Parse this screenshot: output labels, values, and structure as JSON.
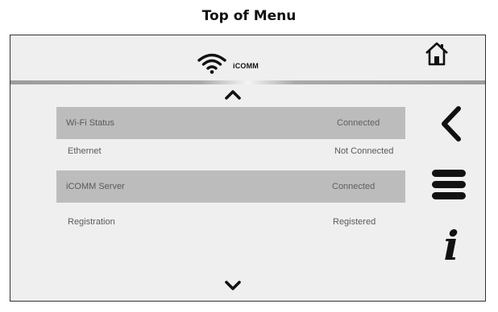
{
  "page": {
    "caption": "Top of Menu"
  },
  "header": {
    "brand": "iCOMM",
    "icons": {
      "wifi": "wifi-icon",
      "home": "home-icon"
    }
  },
  "navigation": {
    "scroll_up_icon": "chevron-up-icon",
    "scroll_down_icon": "chevron-down-icon",
    "back_icon": "chevron-left-icon",
    "menu_icon": "hamburger-menu-icon",
    "info_icon": "info-icon",
    "info_glyph": "i"
  },
  "status_rows": [
    {
      "label": "Wi-Fi Status",
      "value": "Connected"
    },
    {
      "label": "Ethernet",
      "value": "Not Connected"
    },
    {
      "label": "iCOMM Server",
      "value": "Connected"
    },
    {
      "label": "Registration",
      "value": "Registered"
    }
  ],
  "colors": {
    "panel_bg": "#efefef",
    "row_shade": "#bcbcbc",
    "icon": "#111111"
  }
}
